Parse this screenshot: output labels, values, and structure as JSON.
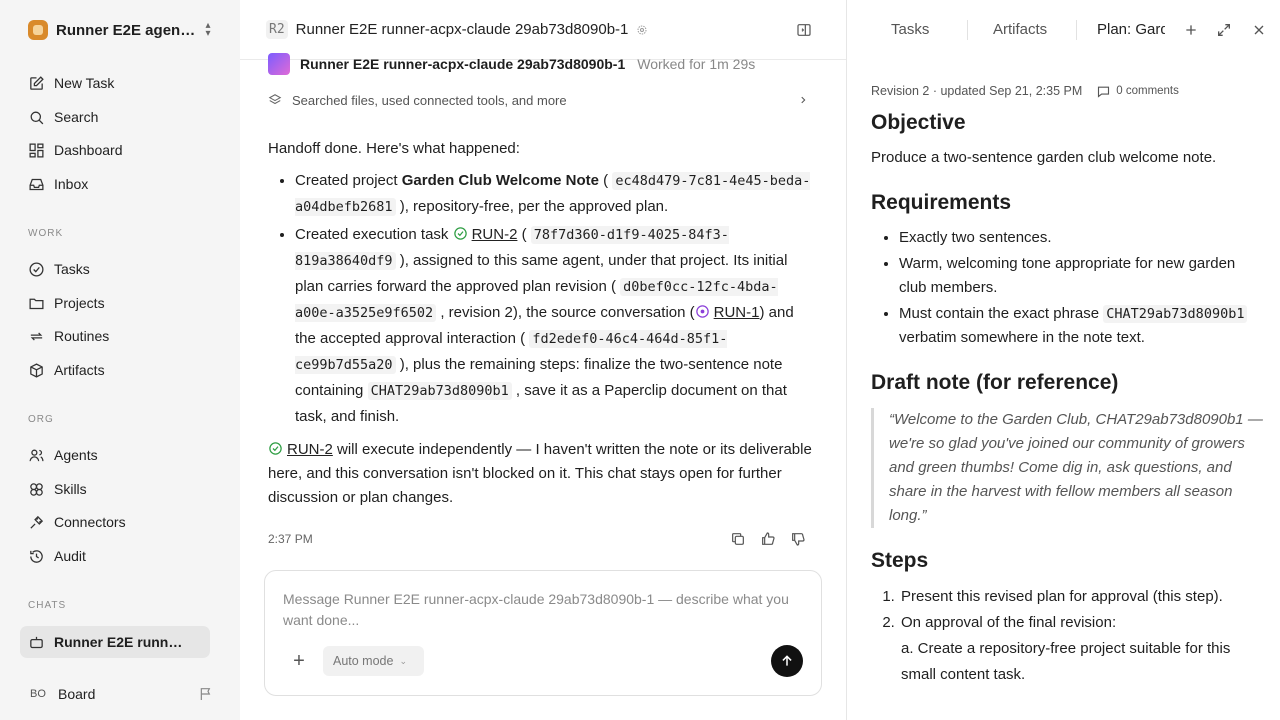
{
  "sidebar": {
    "workspace_name": "Runner E2E agen…",
    "nav": [
      {
        "label": "New Task",
        "icon": "edit-icon"
      },
      {
        "label": "Search",
        "icon": "search-icon"
      },
      {
        "label": "Dashboard",
        "icon": "dashboard-icon"
      },
      {
        "label": "Inbox",
        "icon": "inbox-icon"
      }
    ],
    "work_label": "WORK",
    "work": [
      {
        "label": "Tasks",
        "icon": "check-circle-icon"
      },
      {
        "label": "Projects",
        "icon": "folder-icon"
      },
      {
        "label": "Routines",
        "icon": "repeat-icon"
      },
      {
        "label": "Artifacts",
        "icon": "cube-icon"
      }
    ],
    "org_label": "ORG",
    "org": [
      {
        "label": "Agents",
        "icon": "users-icon"
      },
      {
        "label": "Skills",
        "icon": "skills-icon"
      },
      {
        "label": "Connectors",
        "icon": "plug-icon"
      },
      {
        "label": "Audit",
        "icon": "history-icon"
      }
    ],
    "chats_label": "CHATS",
    "chat_item": "Runner E2E runn…",
    "board_initials": "BO",
    "board_label": "Board"
  },
  "main": {
    "task_id": "R2",
    "task_title": "Runner E2E runner-acpx-claude 29ab73d8090b-1",
    "agent_name": "Runner E2E runner-acpx-claude 29ab73d8090b-1",
    "worked": "Worked for 1m 29s",
    "activity": "Searched files, used connected tools, and more",
    "message": {
      "intro": "Handoff done. Here's what happened:",
      "b1_pre": "Created project ",
      "b1_name": "Garden Club Welcome Note",
      "b1_open": " (",
      "b1_id": "ec48d479-7c81-4e45-beda-a04dbefb2681",
      "b1_post": "), repository-free, per the approved plan.",
      "b2_pre": "Created execution task ",
      "b2_run": "RUN-2",
      "b2_open": " (",
      "b2_id": "78f7d360-d1f9-4025-84f3-819a38640df9",
      "b2_mid1": "), assigned to this same agent, under that project. Its initial plan carries forward the approved plan revision (",
      "b2_rev": "d0bef0cc-12fc-4bda-a00e-a3525e9f6502",
      "b2_mid2": ", revision 2), the source conversation (",
      "b2_run1": "RUN-1",
      "b2_mid3": ") and the accepted approval interaction (",
      "b2_int": "fd2edef0-46c4-464d-85f1-ce99b7d55a20",
      "b2_mid4": "), plus the remaining steps: finalize the two-sentence note containing ",
      "b2_phrase": "CHAT29ab73d8090b1",
      "b2_end": ", save it as a Paperclip document on that task, and finish.",
      "tail_run": "RUN-2",
      "tail_text": " will execute independently — I haven't written the note or its deliverable here, and this conversation isn't blocked on it. This chat stays open for further discussion or plan changes."
    },
    "time": "2:37 PM",
    "composer": {
      "placeholder": "Message Runner E2E runner-acpx-claude 29ab73d8090b-1 — describe what you want done...",
      "mode": "Auto mode"
    }
  },
  "panel": {
    "tabs": [
      "Tasks",
      "Artifacts",
      "Plan: Garden Club"
    ],
    "meta": "Revision 2 · updated Sep 21, 2:35 PM",
    "comments": "0 comments",
    "objective_h": "Objective",
    "objective": "Produce a two-sentence garden club welcome note.",
    "requirements_h": "Requirements",
    "req1": "Exactly two sentences.",
    "req2": "Warm, welcoming tone appropriate for new garden club members.",
    "req3_pre": "Must contain the exact phrase ",
    "req3_code": "CHAT29ab73d8090b1",
    "req3_post": " verbatim somewhere in the note text.",
    "draft_h": "Draft note (for reference)",
    "draft": "“Welcome to the Garden Club, CHAT29ab73d8090b1 — we're so glad you've joined our community of growers and green thumbs! Come dig in, ask questions, and share in the harvest with fellow members all season long.”",
    "steps_h": "Steps",
    "step1": "Present this revised plan for approval (this step).",
    "step2": "On approval of the final revision:",
    "step2a": "a. Create a repository-free project suitable for this small content task."
  }
}
